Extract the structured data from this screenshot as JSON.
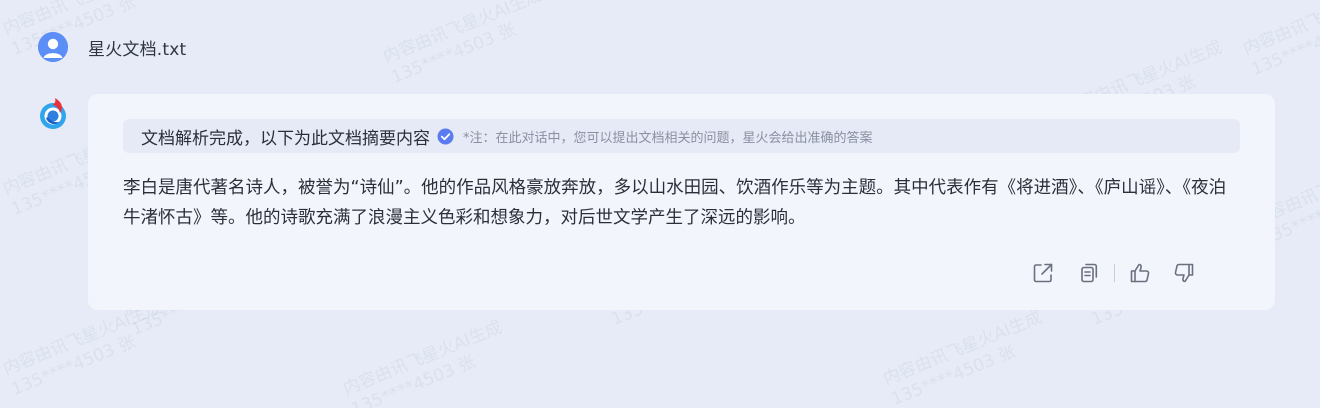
{
  "user_message": {
    "file_name": "星火文档.txt"
  },
  "assistant_message": {
    "banner_title": "文档解析完成，以下为此文档摘要内容",
    "banner_note": "*注：在此对话中，您可以提出文档相关的问题，星火会给出准确的答案",
    "summary_text": "李白是唐代著名诗人，被誉为“诗仙”。他的作品风格豪放奔放，多以山水田园、饮酒作乐等为主题。其中代表作有《将进酒》、《庐山谣》、《夜泊牛渚怀古》等。他的诗歌充满了浪漫主义色彩和想象力，对后世文学产生了深远的影响。",
    "actions": [
      "share-icon",
      "copy-icon",
      "thumbs-up-icon",
      "thumbs-down-icon"
    ]
  },
  "watermark": {
    "line1": "内容由讯飞星火AI生成",
    "line2": "135****4503 张"
  },
  "colors": {
    "background": "#e6ebf7",
    "card": "#f3f5fc",
    "banner": "#e6eaf6",
    "accent": "#5b7bf0"
  }
}
